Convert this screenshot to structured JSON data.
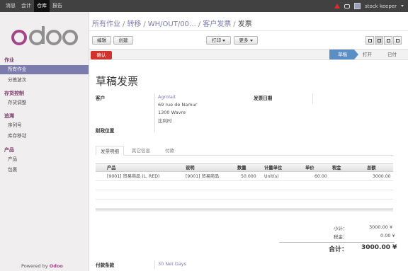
{
  "topbar": {
    "menu": [
      {
        "label": "消息",
        "active": false
      },
      {
        "label": "会计",
        "active": false
      },
      {
        "label": "仓库",
        "active": true
      },
      {
        "label": "报告",
        "active": false
      }
    ],
    "user": "stock keeper"
  },
  "sidebar": {
    "logo_text": "odoo",
    "sections": [
      {
        "title": "作业",
        "items": [
          {
            "label": "所有作业",
            "active": true
          },
          {
            "label": "分拣波次",
            "active": false
          }
        ]
      },
      {
        "title": "存货控制",
        "items": [
          {
            "label": "存货调整",
            "active": false
          }
        ]
      },
      {
        "title": "追溯",
        "items": [
          {
            "label": "序列号",
            "active": false
          },
          {
            "label": "库存移动",
            "active": false
          }
        ]
      },
      {
        "title": "产品",
        "items": [
          {
            "label": "产品",
            "active": false
          },
          {
            "label": "包裹",
            "active": false
          }
        ]
      }
    ],
    "powered_by": "Powered by",
    "powered_brand": "Odoo"
  },
  "breadcrumb": {
    "items": [
      "所有作业",
      "转移",
      "WH/OUT/00…",
      "客户发票"
    ],
    "current": "发票"
  },
  "toolbar": {
    "edit": "编辑",
    "create": "创建",
    "print": "打印",
    "more": "更多"
  },
  "statusbar": {
    "confirm": "确认",
    "stages": [
      "草稿",
      "打开",
      "已付"
    ],
    "active_stage": "草稿"
  },
  "form": {
    "title": "草稿发票",
    "customer_label": "客户",
    "customer_name": "Agrolait",
    "address_line1": "69 rue de Namur",
    "address_line2": "1300 Wavre",
    "address_line3": "比利时",
    "invoice_date_label": "发票日期",
    "fiscal_position_label": "财政位置",
    "tabs": [
      "发票明细",
      "其它信息",
      "付款"
    ],
    "table": {
      "headers": [
        "产品",
        "说明",
        "数量",
        "计量单位",
        "单价",
        "税金",
        "总额"
      ],
      "rows": [
        {
          "product": "[9001] 贸易商品 (L, RED)",
          "description": "[9001] 贸易商品",
          "qty": "50.000",
          "uom": "Unit(s)",
          "price": "60.00",
          "tax": "",
          "total": "3000.00"
        }
      ]
    },
    "subtotal_label": "小计：",
    "subtotal_value": "3000.00 ¥",
    "tax_label": "税金：",
    "tax_value": "0.00 ¥",
    "total_label": "合计：",
    "total_value": "3000.00 ¥",
    "payment_terms_label": "付款条款",
    "payment_terms_value": "30 Net Days"
  },
  "colors": {
    "topbar": "#414141",
    "sidebar_active": "#7c7bad",
    "confirm_button": "#d0322d",
    "stage_active": "#5a8ec5",
    "section_title": "#7c3a6b"
  }
}
